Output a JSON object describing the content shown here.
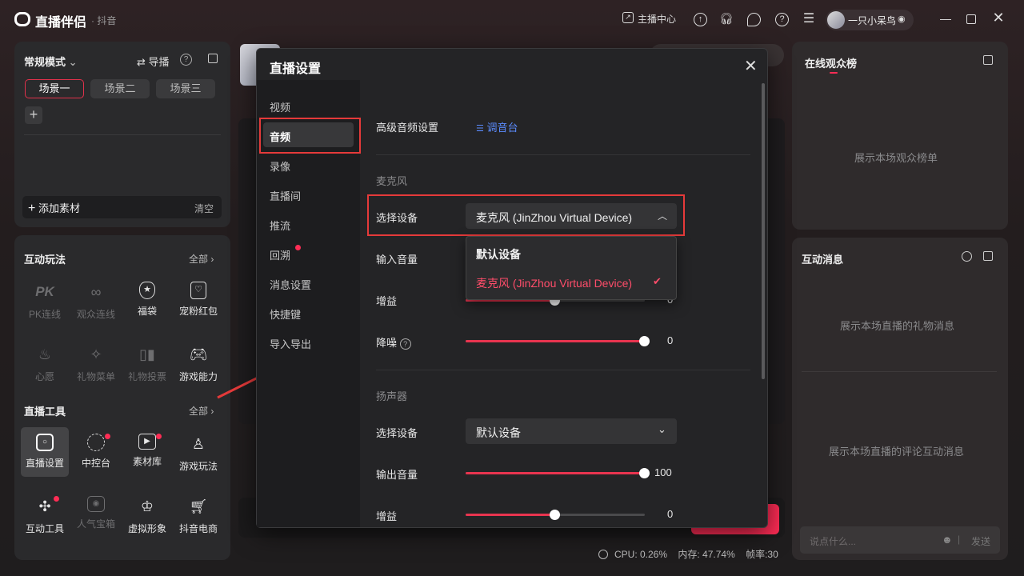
{
  "titlebar": {
    "app_name": "直播伴侣",
    "app_sub": "· 抖音",
    "host_center": "主播中心",
    "user_name": "一只小呆鸟",
    "icons": [
      "chart-icon",
      "upload-icon",
      "headset-icon",
      "chat-icon",
      "help-icon",
      "menu-icon",
      "minimize-icon",
      "maximize-icon",
      "close-icon"
    ]
  },
  "scenes": {
    "mode": "常规模式",
    "guide": "导播",
    "tabs": [
      "场景一",
      "场景二",
      "场景三"
    ],
    "add_material": "添加素材",
    "clear": "清空"
  },
  "interactive_play": {
    "title": "互动玩法",
    "all": "全部",
    "items": [
      {
        "label": "PK连线",
        "enabled": false
      },
      {
        "label": "观众连线",
        "enabled": false
      },
      {
        "label": "福袋",
        "enabled": true
      },
      {
        "label": "宠粉红包",
        "enabled": true
      },
      {
        "label": "心愿",
        "enabled": false
      },
      {
        "label": "礼物菜单",
        "enabled": false
      },
      {
        "label": "礼物投票",
        "enabled": false
      },
      {
        "label": "游戏能力",
        "enabled": true
      }
    ]
  },
  "live_tools": {
    "title": "直播工具",
    "all": "全部",
    "items": [
      {
        "label": "直播设置",
        "enabled": true
      },
      {
        "label": "中控台",
        "enabled": true
      },
      {
        "label": "素材库",
        "enabled": true
      },
      {
        "label": "游戏玩法",
        "enabled": true
      },
      {
        "label": "互动工具",
        "enabled": true
      },
      {
        "label": "人气宝箱",
        "enabled": false
      },
      {
        "label": "虚拟形象",
        "enabled": true
      },
      {
        "label": "抖音电商",
        "enabled": true
      }
    ]
  },
  "right": {
    "audience_title": "在线观众榜",
    "audience_empty": "展示本场观众榜单",
    "messages_title": "互动消息",
    "gift_empty": "展示本场直播的礼物消息",
    "comment_empty": "展示本场直播的评论互动消息",
    "chat_placeholder": "说点什么...",
    "send": "发送"
  },
  "status": {
    "cpu": "CPU: 0.26%",
    "memory": "内存: 47.74%",
    "fps": "帧率:30"
  },
  "dialog": {
    "title": "直播设置",
    "nav": [
      "视频",
      "音频",
      "录像",
      "直播间",
      "推流",
      "回溯",
      "消息设置",
      "快捷键",
      "导入导出"
    ],
    "active_nav": "音频",
    "advanced_label": "高级音频设置",
    "mixer_link": "调音台",
    "mic_section": "麦克风",
    "select_device_label": "选择设备",
    "mic_device": "麦克风 (JinZhou Virtual Device)",
    "input_volume_label": "输入音量",
    "gain_label": "增益",
    "noise_label": "降噪",
    "noise_value": "0",
    "gain_value": "0",
    "mic_gain_progress": 0.5,
    "noise_progress": 1.0,
    "dropdown_options": [
      "默认设备",
      "麦克风 (JinZhou Virtual Device)"
    ],
    "speaker_section": "扬声器",
    "speaker_device": "默认设备",
    "output_volume_label": "输出音量",
    "output_volume_value": "100",
    "output_volume_progress": 1.0,
    "speaker_gain_value": "0",
    "speaker_gain_progress": 0.5
  },
  "colors": {
    "accent": "#ff2c55",
    "link": "#5b8cff",
    "annotation": "#e53a3a"
  }
}
